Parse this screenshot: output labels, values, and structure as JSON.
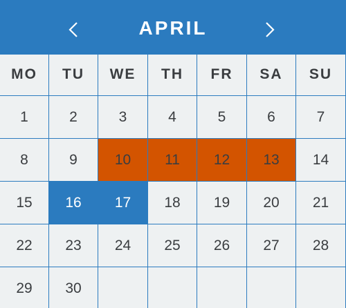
{
  "calendar": {
    "month": "APRIL",
    "prev_icon": "chevron-left-icon",
    "next_icon": "chevron-right-icon",
    "weekdays": [
      "MO",
      "TU",
      "WE",
      "TH",
      "FR",
      "SA",
      "SU"
    ],
    "weeks": [
      [
        "1",
        "2",
        "3",
        "4",
        "5",
        "6",
        "7"
      ],
      [
        "8",
        "9",
        "10",
        "11",
        "12",
        "13",
        "14"
      ],
      [
        "15",
        "16",
        "17",
        "18",
        "19",
        "20",
        "21"
      ],
      [
        "22",
        "23",
        "24",
        "25",
        "26",
        "27",
        "28"
      ],
      [
        "29",
        "30",
        "",
        "",
        "",
        "",
        ""
      ]
    ],
    "range_days": [
      "10",
      "11",
      "12",
      "13"
    ],
    "selected_days": [
      "16",
      "17"
    ]
  },
  "colors": {
    "header": "#2b7bbf",
    "background": "#eef1f2",
    "range": "#d35400",
    "selected": "#2b7bbf",
    "text": "#3a3d40"
  }
}
